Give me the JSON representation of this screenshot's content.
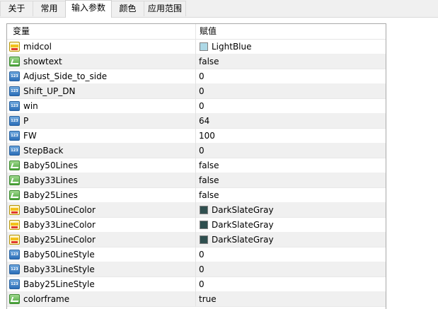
{
  "tabs": [
    {
      "label": "关于",
      "active": false
    },
    {
      "label": "常用",
      "active": false
    },
    {
      "label": "输入参数",
      "active": true
    },
    {
      "label": "颜色",
      "active": false
    },
    {
      "label": "应用范围",
      "active": false
    }
  ],
  "table": {
    "headers": {
      "name": "变量",
      "value": "赋值"
    },
    "rows": [
      {
        "icon": "color-icon",
        "name": "midcol",
        "value": "LightBlue",
        "color": "#add8e6"
      },
      {
        "icon": "bool-icon",
        "name": "showtext",
        "value": "false"
      },
      {
        "icon": "number-icon",
        "name": "Adjust_Side_to_side",
        "value": "0"
      },
      {
        "icon": "number-icon",
        "name": "Shift_UP_DN",
        "value": "0"
      },
      {
        "icon": "number-icon",
        "name": "win",
        "value": "0"
      },
      {
        "icon": "number-icon",
        "name": "P",
        "value": "64"
      },
      {
        "icon": "number-icon",
        "name": "FW",
        "value": "100"
      },
      {
        "icon": "number-icon",
        "name": "StepBack",
        "value": "0"
      },
      {
        "icon": "bool-icon",
        "name": "Baby50Lines",
        "value": "false"
      },
      {
        "icon": "bool-icon",
        "name": "Baby33Lines",
        "value": "false"
      },
      {
        "icon": "bool-icon",
        "name": "Baby25Lines",
        "value": "false"
      },
      {
        "icon": "color-icon",
        "name": "Baby50LineColor",
        "value": "DarkSlateGray",
        "color": "#2f4f4f"
      },
      {
        "icon": "color-icon",
        "name": "Baby33LineColor",
        "value": "DarkSlateGray",
        "color": "#2f4f4f"
      },
      {
        "icon": "color-icon",
        "name": "Baby25LineColor",
        "value": "DarkSlateGray",
        "color": "#2f4f4f"
      },
      {
        "icon": "number-icon",
        "name": "Baby50LineStyle",
        "value": "0"
      },
      {
        "icon": "number-icon",
        "name": "Baby33LineStyle",
        "value": "0"
      },
      {
        "icon": "number-icon",
        "name": "Baby25LineStyle",
        "value": "0"
      },
      {
        "icon": "bool-icon",
        "name": "colorframe",
        "value": "true"
      }
    ]
  }
}
